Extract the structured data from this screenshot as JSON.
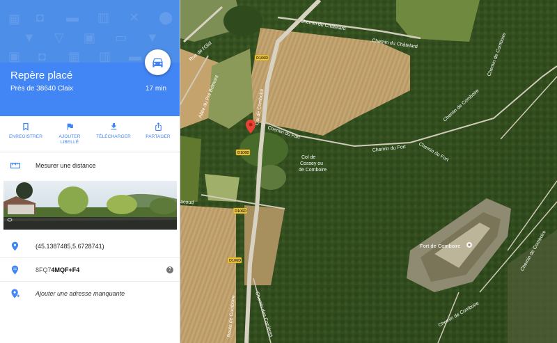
{
  "place": {
    "title": "Repère placé",
    "subtitle": "Près de 38640 Claix",
    "eta": "17 min"
  },
  "hero_icons": [
    "film-icon",
    "shopping-bag-icon",
    "ticket-icon",
    "store-icon",
    "restaurant-icon",
    "pin-icon",
    "bar-icon",
    "coffee-icon",
    "hotel-icon",
    "camera-icon"
  ],
  "actions": [
    {
      "icon": "bookmark-icon",
      "line1": "ENREGISTRER",
      "line2": ""
    },
    {
      "icon": "flag-icon",
      "line1": "AJOUTER",
      "line2": "LIBELLÉ"
    },
    {
      "icon": "download-icon",
      "line1": "TÉLÉCHARGER",
      "line2": ""
    },
    {
      "icon": "share-icon",
      "line1": "PARTAGER",
      "line2": ""
    }
  ],
  "measure": {
    "label": "Mesurer une distance"
  },
  "info": {
    "coordinates": "(45.1387485,5.6728741)",
    "plus_code_prefix": "8FQ7",
    "plus_code_suffix": "4MQF+F4",
    "help": "?",
    "add_address": "Ajouter une adresse manquante"
  },
  "map": {
    "fort_label": "Fort de Comboire",
    "col_line1": "Col de",
    "col_line2": "Cossey ou",
    "col_line3": "de Comboire",
    "roads": {
      "chatelard_1": "Chemin du Châtelard",
      "chatelard_2": "Chemin du Châtelard",
      "oisl": "Rue de l'Oisl",
      "belmont": "Allée du Pré Belmont",
      "col_comboire": "Col de Comboire",
      "fort_1": "Chemin du Fort",
      "fort_2": "Chemin du Fort",
      "fort_3": "Chemin du Fort",
      "comboire_1": "Chemin de Comboire",
      "comboire_2": "Chemin de Comboire",
      "comboire_3": "Chemin de Comboire",
      "comboire_4": "Chemin de Comboire",
      "route_comboire": "Route de Comboire",
      "carrieres": "Chemin des Carrières",
      "acoud": "acoud"
    },
    "shield": "D106D"
  },
  "colors": {
    "primary": "#4285f4",
    "marker": "#e94335"
  }
}
